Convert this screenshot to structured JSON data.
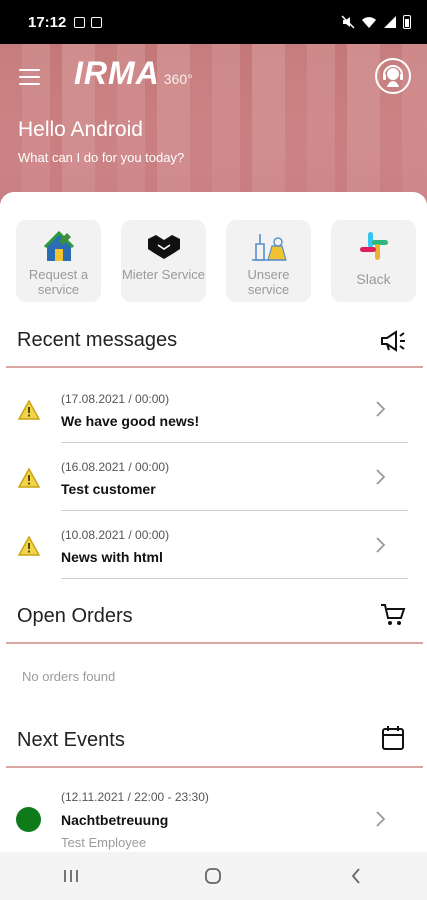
{
  "status_bar": {
    "time": "17:12"
  },
  "header": {
    "logo_text": "IRMA",
    "logo_suffix": "360°",
    "greeting": "Hello Android",
    "subtitle": "What can I do for you today?",
    "accent_color": "#d9a5a5"
  },
  "services": [
    {
      "label": "Request a service",
      "icon": "request-service-icon"
    },
    {
      "label": "Mieter Service",
      "icon": "handshake-icon"
    },
    {
      "label": "Unsere service",
      "icon": "cleaning-tools-icon"
    },
    {
      "label": "Slack",
      "icon": "slack-icon"
    }
  ],
  "recent_messages": {
    "title": "Recent messages",
    "icon": "megaphone-icon",
    "items": [
      {
        "date": "(17.08.2021 / 00:00)",
        "title": "We have good news!"
      },
      {
        "date": "(16.08.2021 / 00:00)",
        "title": "Test customer"
      },
      {
        "date": "(10.08.2021 / 00:00)",
        "title": "News with html"
      }
    ]
  },
  "open_orders": {
    "title": "Open Orders",
    "icon": "cart-icon",
    "empty_text": "No orders found"
  },
  "next_events": {
    "title": "Next Events",
    "icon": "calendar-icon",
    "items": [
      {
        "date": "(12.11.2021 / 22:00 - 23:30)",
        "title": "Nachtbetreuung",
        "employee": "Test Employee",
        "status_color": "#0e7a1a"
      }
    ]
  }
}
